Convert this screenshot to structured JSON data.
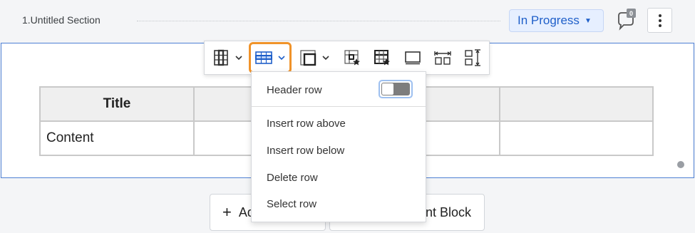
{
  "section": {
    "title": "1.Untitled Section",
    "status": "In Progress",
    "comment_count": "0"
  },
  "icons": {
    "status_caret": "caret-down-icon",
    "comment": "comment-bubble-icon",
    "more": "more-vertical-icon",
    "toolbar": [
      "table-columns-icon",
      "table-rows-icon",
      "table-cell-icon",
      "table-style-icon",
      "table-format-icon",
      "display-icon",
      "distribute-columns-icon",
      "distribute-rows-icon"
    ]
  },
  "table": {
    "header": [
      "Title",
      "",
      "",
      ""
    ],
    "rows": [
      [
        "Content",
        "",
        "",
        ""
      ]
    ]
  },
  "row_menu": {
    "header_row_label": "Header row",
    "header_row_on": true,
    "items": [
      "Insert row above",
      "Insert row below",
      "Delete row",
      "Select row"
    ]
  },
  "bottom": {
    "add_label": "Ad",
    "block_label": "nt Block"
  },
  "colors": {
    "accent_blue": "#1f5fc9",
    "status_bg": "#e6efff",
    "active_outline": "#f0932a",
    "block_border": "#4d7fd4"
  }
}
